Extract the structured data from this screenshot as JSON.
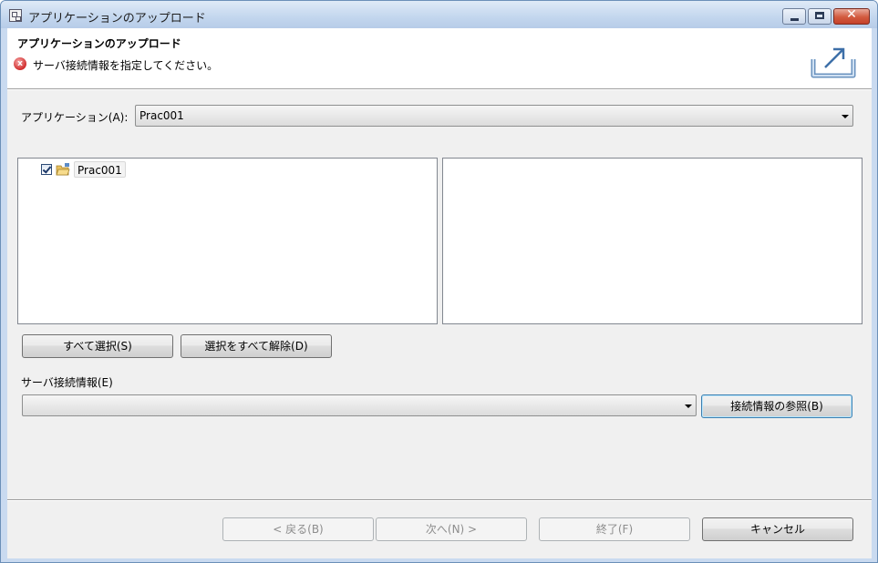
{
  "window": {
    "title": "アプリケーションのアップロード",
    "minimize_icon": "minimize-icon",
    "maximize_icon": "maximize-icon",
    "close_glyph": "✕"
  },
  "header": {
    "title": "アプリケーションのアップロード",
    "error_glyph": "x",
    "message": "サーバ接続情報を指定してください。"
  },
  "application": {
    "label": "アプリケーション(A):",
    "selected": "Prac001"
  },
  "tree": {
    "items": [
      {
        "label": "Prac001",
        "checked": true
      }
    ]
  },
  "selection_buttons": {
    "select_all": "すべて選択(S)",
    "deselect_all": "選択をすべて解除(D)"
  },
  "server": {
    "label": "サーバ接続情報(E)",
    "selected": "",
    "browse_button": "接続情報の参照(B)"
  },
  "footer": {
    "back": "< 戻る(B)",
    "next": "次へ(N) >",
    "finish": "終了(F)",
    "cancel": "キャンセル"
  },
  "colors": {
    "error": "#d12d2d",
    "accent": "#3c7fb1",
    "window_frame": "#c9daf0"
  }
}
